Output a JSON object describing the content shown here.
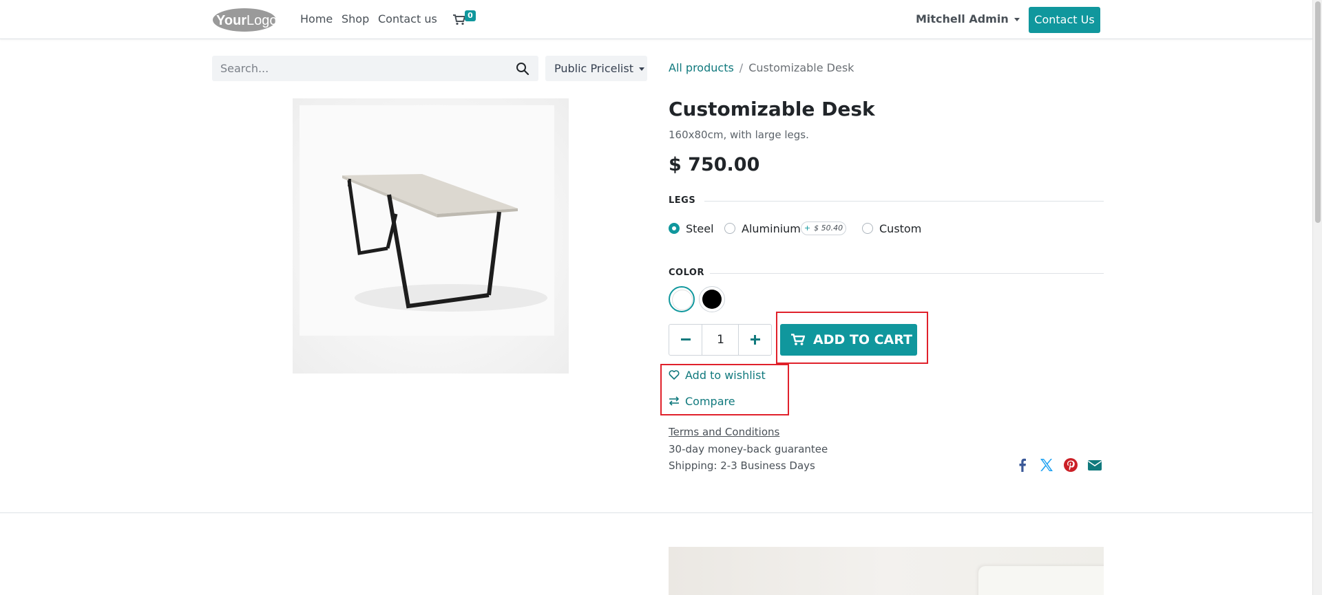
{
  "navbar": {
    "logo_text": "YourLogo",
    "links": {
      "home": "Home",
      "shop": "Shop",
      "contact": "Contact us"
    },
    "cart_count": "0",
    "user": "Mitchell Admin",
    "cta": "Contact Us"
  },
  "search": {
    "placeholder": "Search..."
  },
  "pricelist": {
    "label": "Public Pricelist"
  },
  "breadcrumb": {
    "parent": "All products",
    "separator": "/",
    "current": "Customizable Desk"
  },
  "product": {
    "name": "Customizable Desk",
    "description": "160x80cm, with large legs.",
    "price": "$ 750.00",
    "attributes": {
      "legs": {
        "label": "LEGS",
        "options": [
          "Steel",
          "Aluminium",
          "Custom"
        ],
        "selected": "Steel",
        "extra_price": "$ 50.40"
      },
      "color": {
        "label": "COLOR",
        "swatches": [
          "#ffffff",
          "#000000"
        ],
        "selected": "#ffffff"
      }
    },
    "quantity": "1",
    "add_to_cart": "ADD TO CART",
    "wishlist": "Add to wishlist",
    "compare": "Compare",
    "terms": "Terms and Conditions",
    "guarantee": "30-day money-back guarantee",
    "shipping": "Shipping: 2-3 Business Days"
  },
  "share": [
    "facebook-icon",
    "x-icon",
    "pinterest-icon",
    "email-icon"
  ],
  "colors": {
    "accent": "#10979d",
    "link": "#10797d",
    "highlight": "#e0202a",
    "corner": "#714b67"
  }
}
